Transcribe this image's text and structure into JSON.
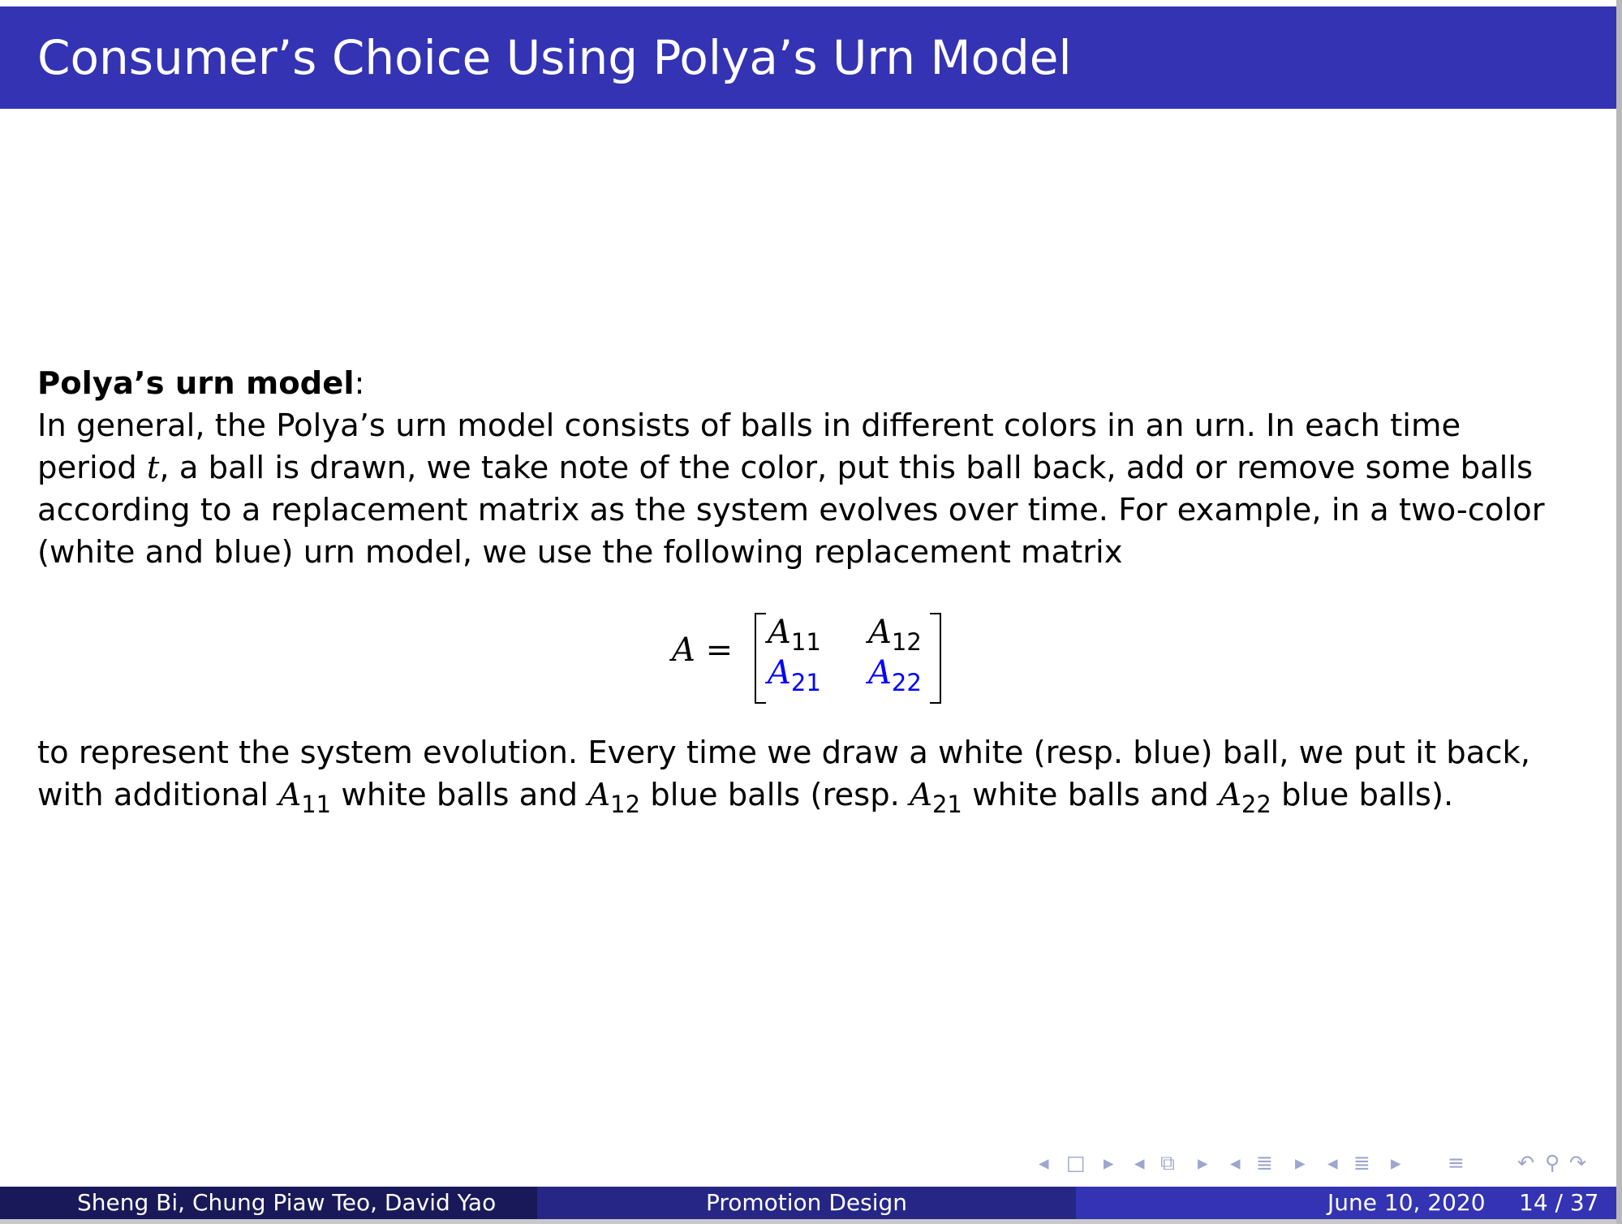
{
  "title": "Consumer’s Choice Using Polya’s Urn Model",
  "heading": {
    "bold": "Polya’s urn model",
    "colon": ":"
  },
  "paragraph1": {
    "line1": "In general, the Polya’s urn model consists of balls in different colors in an urn. In each time",
    "line2_a": "period ",
    "line2_var": "t",
    "line2_b": ", a ball is drawn, we take note of the color, put this ball back, add or remove some balls",
    "line3": "according to a replacement matrix as the system evolves over time. For example, in a two-color",
    "line4": "(white and blue) urn model, we use the following replacement matrix"
  },
  "equation": {
    "lhs": "A =",
    "cells": [
      {
        "base": "A",
        "sub": "11",
        "color": "#000000"
      },
      {
        "base": "A",
        "sub": "12",
        "color": "#000000"
      },
      {
        "base": "A",
        "sub": "21",
        "color": "#0000ff"
      },
      {
        "base": "A",
        "sub": "22",
        "color": "#0000ff"
      }
    ]
  },
  "paragraph2": {
    "line1": "to represent the system evolution. Every time we draw a white (resp. blue) ball, we put it back,",
    "line2": {
      "t1": "with additional ",
      "v1": "A",
      "s1": "11",
      "t2": " white balls and ",
      "v2": "A",
      "s2": "12",
      "t3": " blue balls (resp. ",
      "v3": "A",
      "s3": "21",
      "t4": " white balls and ",
      "v4": "A",
      "s4": "22",
      "t5": " blue balls)."
    }
  },
  "nav_icons": [
    "prev-frame-arrow-icon",
    "frame-icon",
    "next-frame-arrow-icon",
    "prev-subsection-arrow-icon",
    "subsection-icon",
    "next-subsection-arrow-icon",
    "prev-section-arrow-icon",
    "section-icon",
    "next-section-arrow-icon",
    "prev-document-arrow-icon",
    "document-icon",
    "next-document-arrow-icon",
    "appendix-icon",
    "back-icon",
    "search-icon",
    "forward-icon"
  ],
  "footer": {
    "authors": "Sheng Bi, Chung Piaw Teo, David Yao",
    "short_title": "Promotion Design",
    "date": "June 10, 2020",
    "page": "14 / 37"
  },
  "colors": {
    "title_bar": "#3333b3",
    "footer_left": "#191959",
    "footer_mid": "#262686",
    "footer_right": "#3333b3",
    "matrix_highlight": "#0000ff"
  }
}
